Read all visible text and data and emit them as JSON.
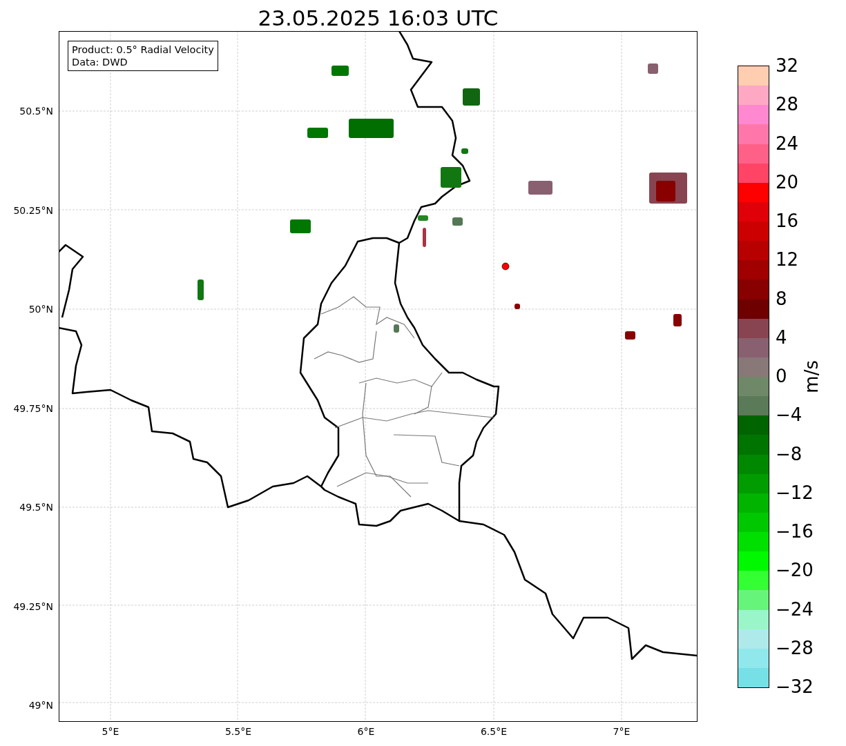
{
  "title": "23.05.2025 16:03 UTC",
  "info_box": {
    "lines": [
      "Product: 0.5° Radial Velocity",
      "Data: DWD"
    ]
  },
  "map": {
    "y_axis_labels": [
      "50.5°N",
      "50.25°N",
      "50°N",
      "49.75°N",
      "49.5°N",
      "49.25°N",
      "49°N"
    ],
    "x_axis_labels": [
      "5°E",
      "5.5°E",
      "6°E",
      "6.5°E",
      "7°E"
    ]
  },
  "colorbar": {
    "label": "m/s",
    "ticks": [
      "32",
      "28",
      "24",
      "20",
      "16",
      "12",
      "8",
      "4",
      "0",
      "−4",
      "−8",
      "−12",
      "−16",
      "−20",
      "−24",
      "−28",
      "−32"
    ],
    "bands": [
      {
        "color": "#ffcdb0"
      },
      {
        "color": "#ffa8c4"
      },
      {
        "color": "#ff88d0"
      },
      {
        "color": "#ff77aa"
      },
      {
        "color": "#ff6088"
      },
      {
        "color": "#ff4466"
      },
      {
        "color": "#ff0000"
      },
      {
        "color": "#e00008"
      },
      {
        "color": "#cc0000"
      },
      {
        "color": "#b80000"
      },
      {
        "color": "#a00000"
      },
      {
        "color": "#880000"
      },
      {
        "color": "#6e0000"
      },
      {
        "color": "#884450"
      },
      {
        "color": "#886070"
      },
      {
        "color": "#887878"
      },
      {
        "color": "#6e8868"
      },
      {
        "color": "#5a7a58"
      },
      {
        "color": "#006400"
      },
      {
        "color": "#007400"
      },
      {
        "color": "#008800"
      },
      {
        "color": "#009c00"
      },
      {
        "color": "#00b400"
      },
      {
        "color": "#00c800"
      },
      {
        "color": "#00e000"
      },
      {
        "color": "#00f800"
      },
      {
        "color": "#33ff33"
      },
      {
        "color": "#66f57a"
      },
      {
        "color": "#9af5c8"
      },
      {
        "color": "#aeeaea"
      },
      {
        "color": "#90e8ec"
      },
      {
        "color": "#77e0e6"
      }
    ]
  }
}
